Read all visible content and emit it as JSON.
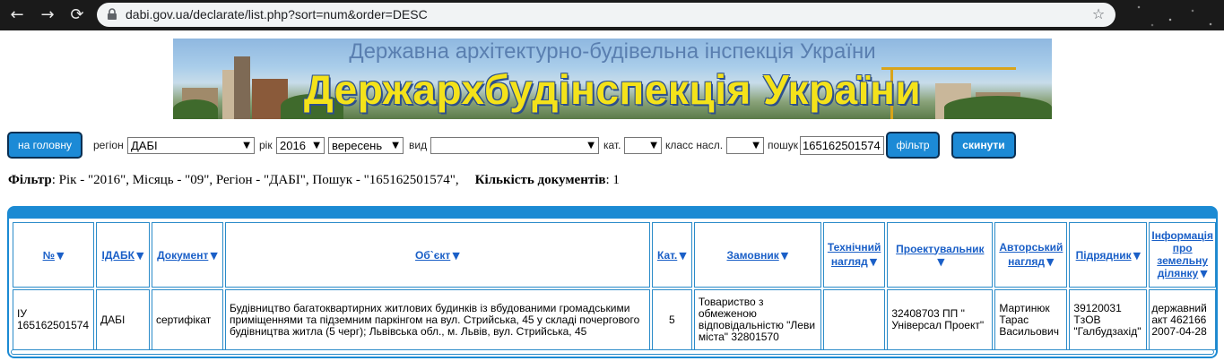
{
  "browser": {
    "url": "dabi.gov.ua/declarate/list.php?sort=num&order=DESC"
  },
  "banner": {
    "subtitle": "Державна архітектурно-будівельна інспекція України",
    "title": "Держархбудінспекція України"
  },
  "filters": {
    "home_button": "на головну",
    "region_label": "регіон",
    "region_value": "ДАБІ",
    "year_label": "рік",
    "year_value": "2016",
    "month_value": "вересень",
    "type_label": "вид",
    "type_value": "",
    "category_label": "кат.",
    "category_value": "",
    "class_label": "класс насл.",
    "class_value": "",
    "search_label": "пошук",
    "search_value": "165162501574",
    "filter_button": "фільтр",
    "reset_button": "скинути"
  },
  "filter_summary": {
    "filter_label": "Фільтр",
    "filter_text": ": Рік - \"2016\", Місяць - \"09\", Регіон - \"ДАБІ\", Пошук - \"165162501574\",",
    "count_label": "Кількість документів",
    "count_text": ": 1"
  },
  "table": {
    "headers": {
      "num": "№",
      "idabk": "ІДАБК",
      "doc": "Документ",
      "object": "Об`єкт",
      "cat": "Кат.",
      "customer": "Замовник",
      "tech_a": "Технічний",
      "tech_b": "нагляд",
      "designer": "Проектувальник",
      "author_a": "Авторський",
      "author_b": "нагляд",
      "contractor": "Підрядник",
      "land_a": "Інформація",
      "land_b": "про",
      "land_c": "земельну",
      "land_d": "ділянку"
    },
    "row": {
      "num_a": "ІУ",
      "num_b": "165162501574",
      "idabk": "ДАБІ",
      "doc": "сертифікат",
      "object": "Будівництво багатоквартирних житлових будинків із вбудованими громадськими приміщеннями та підземним паркінгом на вул. Стрийська, 45 у складі почергового будівництва житла (5 черг); Львівська обл., м. Львів, вул. Стрийська, 45",
      "cat": "5",
      "customer": "Товариство з обмеженою відповідальністю \"Леви міста\" 32801570",
      "tech": "",
      "designer": "32408703 ПП \" Універсал Проект\"",
      "author": "Мартинюк Тарас Васильович",
      "contractor": "39120031 ТзОВ \"Галбудзахід\"",
      "land": "державний акт 462166 2007-04-28"
    }
  },
  "colors": {
    "accent": "#1b8ad3",
    "link": "#1a5fc7",
    "banner_title": "#f4e21a"
  }
}
